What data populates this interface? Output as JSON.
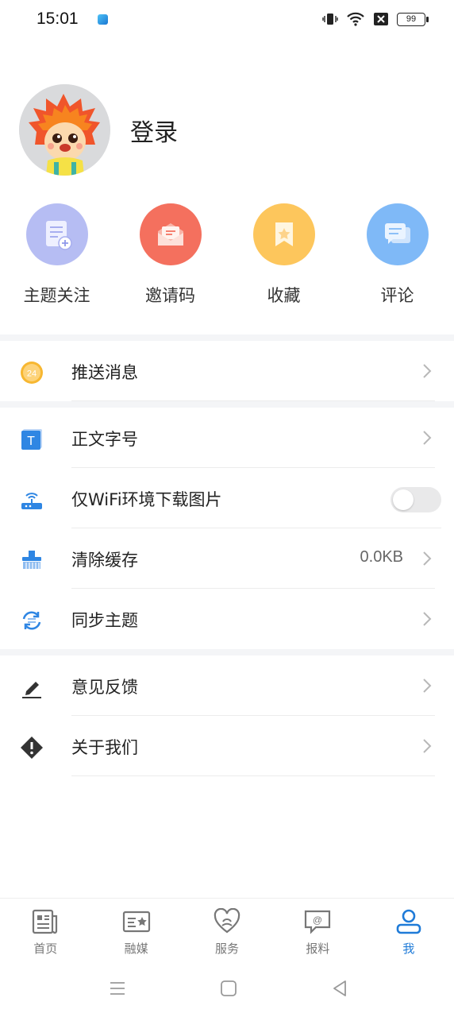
{
  "status_bar": {
    "time": "15:01",
    "battery": "99"
  },
  "profile": {
    "login_label": "登录"
  },
  "quick_actions": [
    {
      "label": "主题关注",
      "icon": "topic-follow-icon",
      "color": "#b6bdf3"
    },
    {
      "label": "邀请码",
      "icon": "invite-code-icon",
      "color": "#f4705e"
    },
    {
      "label": "收藏",
      "icon": "bookmark-icon",
      "color": "#fdc65c"
    },
    {
      "label": "评论",
      "icon": "comment-icon",
      "color": "#7fb9f7"
    }
  ],
  "menu": {
    "push": {
      "label": "推送消息",
      "icon_text": "24"
    },
    "font_size": {
      "label": "正文字号",
      "icon_text": "T"
    },
    "wifi_images": {
      "label": "仅WiFi环境下载图片",
      "enabled": false
    },
    "clear_cache": {
      "label": "清除缓存",
      "value": "0.0KB"
    },
    "sync_topics": {
      "label": "同步主题"
    },
    "feedback": {
      "label": "意见反馈"
    },
    "about": {
      "label": "关于我们"
    }
  },
  "bottom_nav": [
    {
      "label": "首页",
      "icon": "home-news-icon",
      "active": false
    },
    {
      "label": "融媒",
      "icon": "media-card-icon",
      "active": false
    },
    {
      "label": "服务",
      "icon": "service-heart-icon",
      "active": false
    },
    {
      "label": "报料",
      "icon": "report-chat-icon",
      "active": false
    },
    {
      "label": "我",
      "icon": "profile-user-icon",
      "active": true
    }
  ],
  "colors": {
    "accent": "#1f7bd8",
    "separator": "#f4f5f7"
  }
}
